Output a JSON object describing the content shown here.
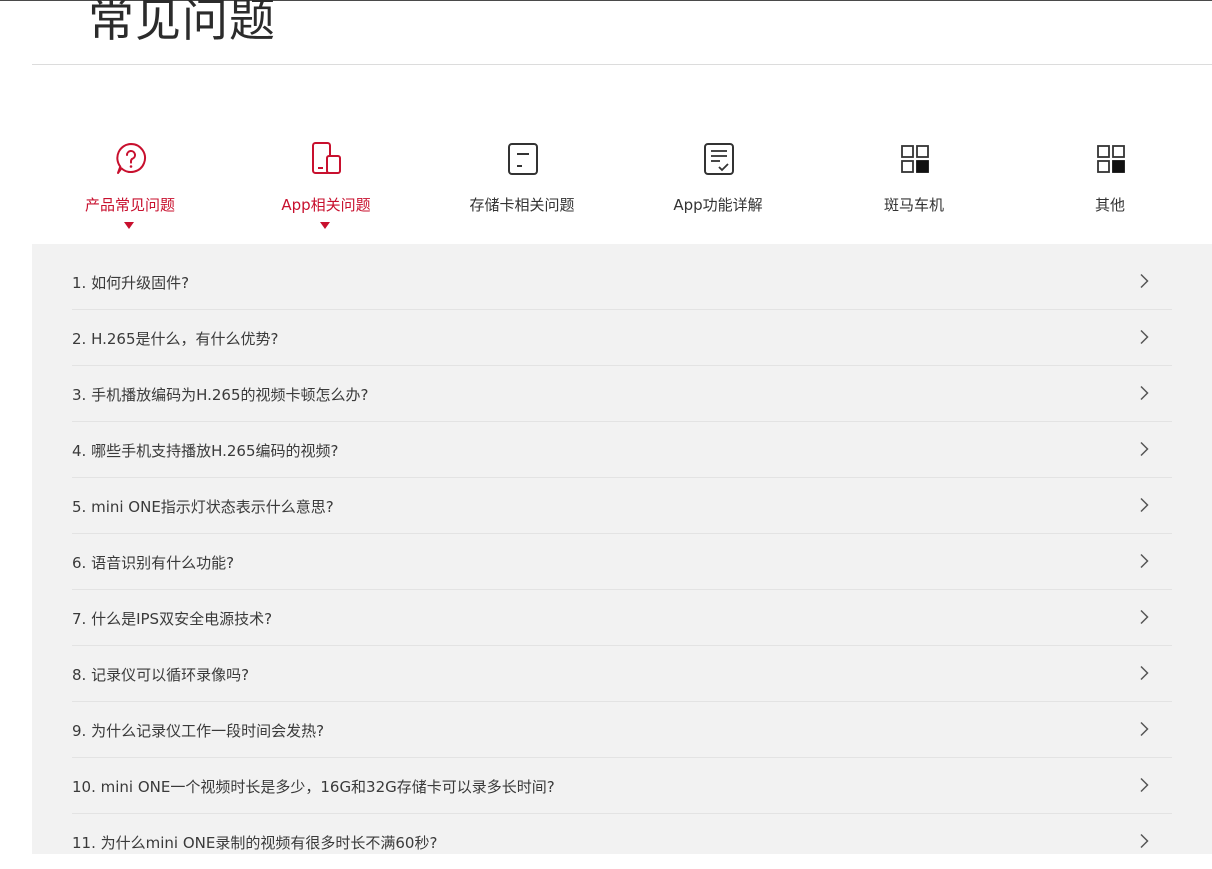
{
  "page": {
    "title": "常见问题"
  },
  "tabs": [
    {
      "label": "产品常见问题",
      "icon": "question-bubble-icon",
      "active": true
    },
    {
      "label": "App相关问题",
      "icon": "phone-tablet-icon",
      "active": true
    },
    {
      "label": "存储卡相关问题",
      "icon": "memory-card-icon",
      "active": false
    },
    {
      "label": "App功能详解",
      "icon": "document-check-icon",
      "active": false
    },
    {
      "label": "斑马车机",
      "icon": "apps-grid-icon",
      "active": false
    },
    {
      "label": "其他",
      "icon": "apps-grid-icon",
      "active": false
    }
  ],
  "faq": [
    "1. 如何升级固件?",
    "2. H.265是什么，有什么优势?",
    "3. 手机播放编码为H.265的视频卡顿怎么办?",
    "4. 哪些手机支持播放H.265编码的视频?",
    "5. mini ONE指示灯状态表示什么意思?",
    "6. 语音识别有什么功能?",
    "7. 什么是IPS双安全电源技术?",
    "8. 记录仪可以循环录像吗?",
    "9. 为什么记录仪工作一段时间会发热?",
    "10. mini ONE一个视频时长是多少，16G和32G存储卡可以录多长时间?",
    "11. 为什么mini ONE录制的视频有很多时长不满60秒?"
  ],
  "colors": {
    "accent": "#c8102e",
    "icon_default": "#333333",
    "panel_bg": "#f2f2f2"
  }
}
